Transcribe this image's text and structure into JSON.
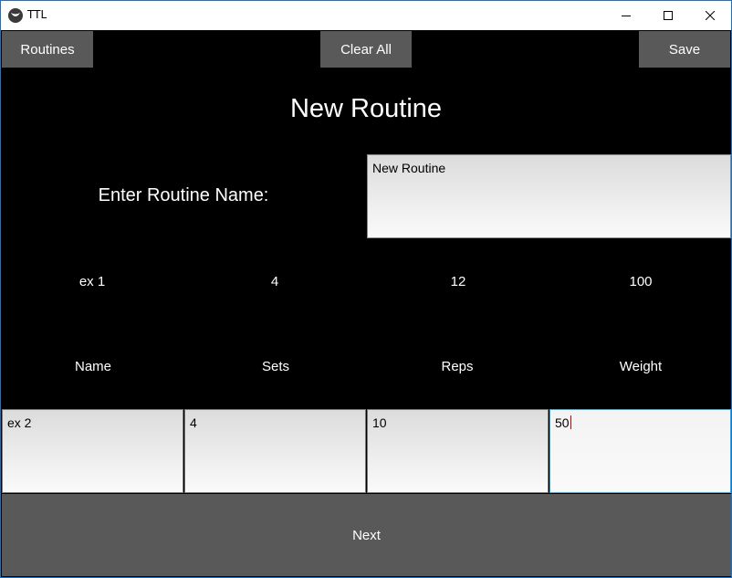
{
  "window": {
    "title": "TTL",
    "controls": {
      "minimize": "minimize-icon",
      "maximize": "maximize-icon",
      "close": "close-icon"
    }
  },
  "toolbar": {
    "routines_label": "Routines",
    "clear_all_label": "Clear All",
    "save_label": "Save"
  },
  "page": {
    "title": "New Routine",
    "name_label": "Enter Routine Name:",
    "name_value": "New Routine"
  },
  "exercise_row": {
    "name": "ex 1",
    "sets": "4",
    "reps": "12",
    "weight": "100"
  },
  "columns": {
    "name": "Name",
    "sets": "Sets",
    "reps": "Reps",
    "weight": "Weight"
  },
  "new_exercise": {
    "name": "ex 2",
    "sets": "4",
    "reps": "10",
    "weight": "50"
  },
  "next_label": "Next",
  "colors": {
    "background": "#000000",
    "button": "#595959",
    "focus_border": "#3aa3d8"
  }
}
